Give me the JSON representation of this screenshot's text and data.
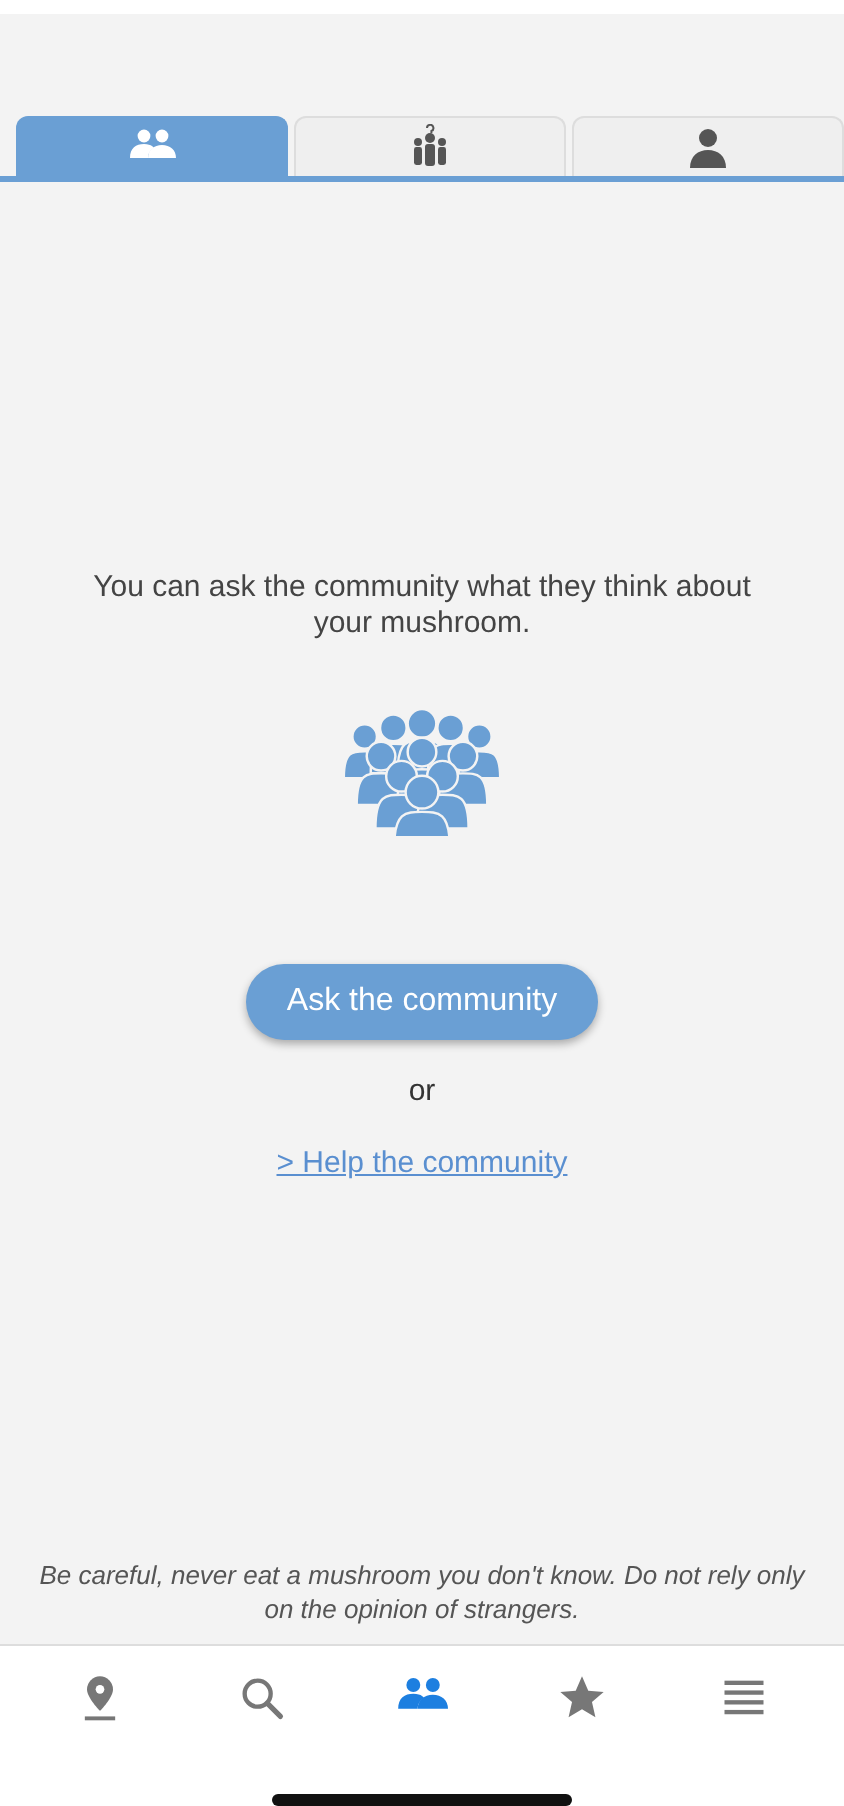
{
  "tabs": [
    {
      "kind": "duo",
      "selected": true
    },
    {
      "kind": "crowd-question",
      "selected": false
    },
    {
      "kind": "person",
      "selected": false
    }
  ],
  "intro": "You can ask the community what they think about your mushroom.",
  "ask_button": "Ask the community",
  "separator": "or",
  "help_link": "> Help the community",
  "warning": "Be careful, never eat a mushroom you don't know. Do not rely only on the opinion of strangers.",
  "nav": [
    {
      "kind": "pin",
      "selected": false
    },
    {
      "kind": "search",
      "selected": false
    },
    {
      "kind": "duo",
      "selected": true
    },
    {
      "kind": "star",
      "selected": false
    },
    {
      "kind": "list",
      "selected": false
    }
  ]
}
